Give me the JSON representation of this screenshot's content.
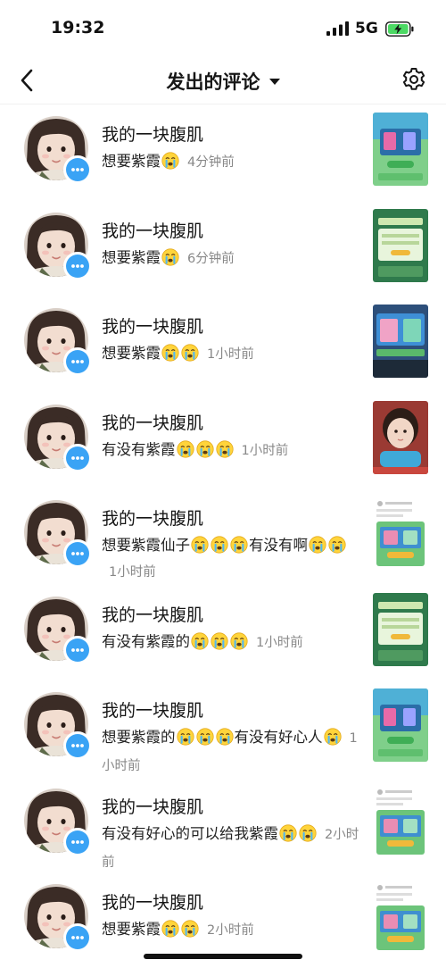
{
  "status_bar": {
    "time": "19:32",
    "network": "5G",
    "signal_icon": "signal-bars-icon",
    "battery_icon": "battery-charging-icon"
  },
  "nav": {
    "title": "发出的评论",
    "back_icon": "chevron-left-icon",
    "dropdown_icon": "caret-down-icon",
    "settings_icon": "gear-icon"
  },
  "colors": {
    "badge_blue": "#3aa3f5",
    "time_gray": "#888888",
    "text": "#161616"
  },
  "comments": [
    {
      "username": "我的一块腹肌",
      "parts": [
        {
          "t": "想要紫霞"
        },
        {
          "e": "crying-emoji"
        }
      ],
      "time": "4分钟前",
      "thumb": "game-screenshot-green"
    },
    {
      "username": "我的一块腹肌",
      "parts": [
        {
          "t": "想要紫霞"
        },
        {
          "e": "crying-emoji"
        }
      ],
      "time": "6分钟前",
      "thumb": "game-invite-card"
    },
    {
      "username": "我的一块腹肌",
      "parts": [
        {
          "t": "想要紫霞"
        },
        {
          "e": "crying-emoji"
        },
        {
          "e": "crying-emoji"
        }
      ],
      "time": "1小时前",
      "thumb": "game-screenshot-blue"
    },
    {
      "username": "我的一块腹肌",
      "parts": [
        {
          "t": "有没有紫霞"
        },
        {
          "e": "crying-emoji"
        },
        {
          "e": "crying-emoji"
        },
        {
          "e": "crying-emoji"
        }
      ],
      "time": "1小时前",
      "thumb": "child-photo"
    },
    {
      "username": "我的一块腹肌",
      "parts": [
        {
          "t": "想要紫霞仙子"
        },
        {
          "e": "crying-emoji"
        },
        {
          "e": "crying-emoji"
        },
        {
          "e": "crying-emoji"
        },
        {
          "t": "有没有啊"
        },
        {
          "e": "crying-emoji"
        },
        {
          "e": "crying-emoji"
        }
      ],
      "time": "1小时前",
      "thumb": "chat-screenshot"
    },
    {
      "username": "我的一块腹肌",
      "parts": [
        {
          "t": "有没有紫霞的"
        },
        {
          "e": "crying-emoji"
        },
        {
          "e": "crying-emoji"
        },
        {
          "e": "crying-emoji"
        }
      ],
      "time": "1小时前",
      "thumb": "game-invite-card"
    },
    {
      "username": "我的一块腹肌",
      "parts": [
        {
          "t": "想要紫霞的"
        },
        {
          "e": "crying-emoji"
        },
        {
          "e": "crying-emoji"
        },
        {
          "e": "crying-emoji"
        },
        {
          "t": "有没有好心人"
        },
        {
          "e": "crying-emoji"
        }
      ],
      "time": "1小时前",
      "thumb": "game-screenshot-green"
    },
    {
      "username": "我的一块腹肌",
      "parts": [
        {
          "t": "有没有好心的可以给我紫霞"
        },
        {
          "e": "crying-emoji"
        },
        {
          "e": "crying-emoji"
        }
      ],
      "time": "2小时前",
      "thumb": "chat-screenshot"
    },
    {
      "username": "我的一块腹肌",
      "parts": [
        {
          "t": "想要紫霞"
        },
        {
          "e": "crying-emoji"
        },
        {
          "e": "crying-emoji"
        }
      ],
      "time": "2小时前",
      "thumb": "chat-screenshot"
    }
  ]
}
